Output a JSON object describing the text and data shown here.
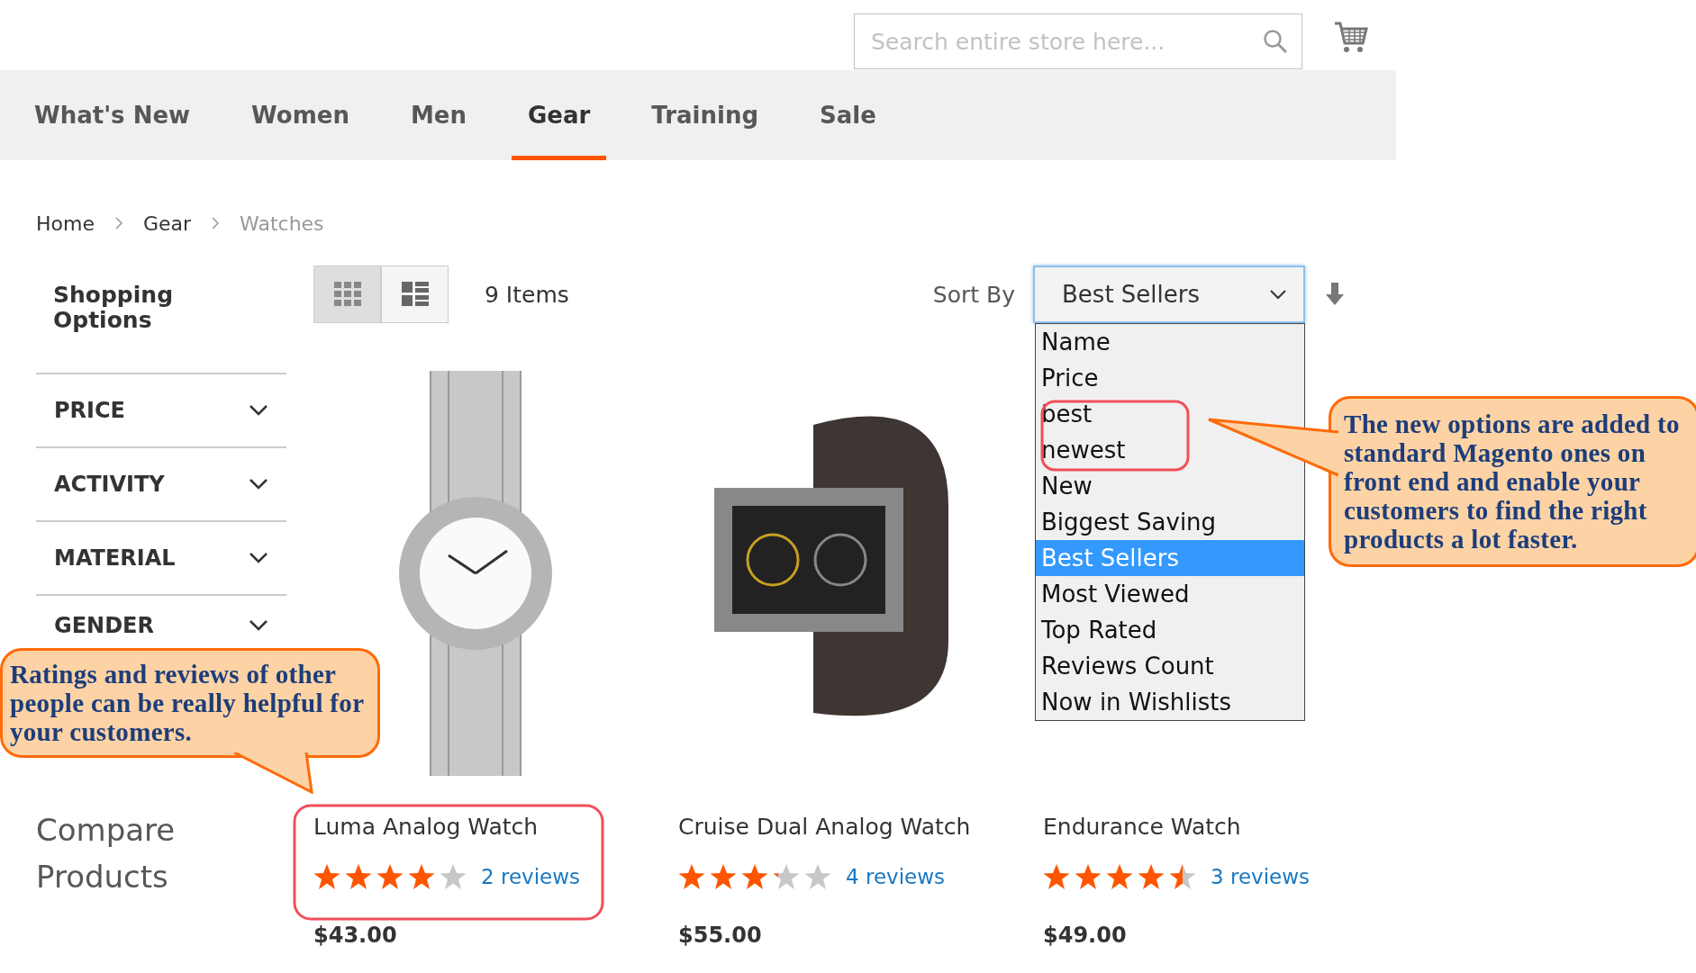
{
  "header": {
    "search": {
      "placeholder": "Search entire store here..."
    }
  },
  "nav": [
    {
      "label": "What's New",
      "selected": false
    },
    {
      "label": "Women",
      "selected": false
    },
    {
      "label": "Men",
      "selected": false
    },
    {
      "label": "Gear",
      "selected": true
    },
    {
      "label": "Training",
      "selected": false
    },
    {
      "label": "Sale",
      "selected": false
    }
  ],
  "breadcrumb": [
    "Home",
    "Gear",
    "Watches"
  ],
  "sidebar": {
    "title": "Shopping Options",
    "filters": [
      {
        "label": "PRICE",
        "expanded": false
      },
      {
        "label": "ACTIVITY",
        "expanded": false
      },
      {
        "label": "MATERIAL",
        "expanded": false
      },
      {
        "label": "GENDER",
        "expanded": false
      }
    ],
    "compare": "Compare Products"
  },
  "toolbar": {
    "view_modes": [
      {
        "kind": "grid",
        "selected": true
      },
      {
        "kind": "list",
        "selected": false
      }
    ],
    "count": "9 Items",
    "sort_label": "Sort By",
    "sort_value": "Best Sellers",
    "sort_options": [
      {
        "label": "Name",
        "selected": false
      },
      {
        "label": "Price",
        "selected": false
      },
      {
        "label": "best",
        "selected": false
      },
      {
        "label": "newest",
        "selected": false
      },
      {
        "label": "New",
        "selected": false
      },
      {
        "label": "Biggest Saving",
        "selected": false
      },
      {
        "label": "Best Sellers",
        "selected": true
      },
      {
        "label": "Most Viewed",
        "selected": false
      },
      {
        "label": "Top Rated",
        "selected": false
      },
      {
        "label": "Reviews Count",
        "selected": false
      },
      {
        "label": "Now in Wishlists",
        "selected": false
      }
    ]
  },
  "products": [
    {
      "name": "Luma Analog Watch",
      "stars": 4,
      "reviews": "2 reviews",
      "price": "$43.00"
    },
    {
      "name": "Cruise Dual Analog Watch",
      "stars": 3.2,
      "reviews": "4 reviews",
      "price": "$55.00"
    },
    {
      "name": "Endurance Watch",
      "stars": 4.5,
      "reviews": "3 reviews",
      "price": "$49.00"
    }
  ],
  "callouts": [
    {
      "kind": "right",
      "text": "The new options are added to standard Magento ones on front end and enable your customers to find the right products a lot faster."
    },
    {
      "kind": "left",
      "text": "Ratings and reviews of other people can be really helpful for your customers."
    }
  ]
}
